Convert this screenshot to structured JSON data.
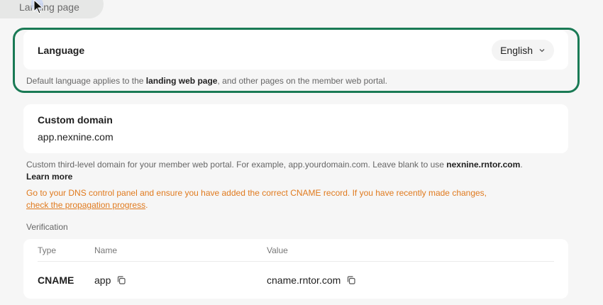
{
  "top_tab": {
    "label": "Landing page"
  },
  "language": {
    "title": "Language",
    "selected": "English",
    "help_prefix": "Default language applies to the ",
    "help_bold": "landing web page",
    "help_suffix": ", and other pages on the member web portal."
  },
  "custom_domain": {
    "title": "Custom domain",
    "value": "app.nexnine.com",
    "help_prefix": "Custom third-level domain for your member web portal. For example, app.yourdomain.com. Leave blank to use ",
    "help_bold": "nexnine.rntor.com",
    "help_suffix": ".",
    "learn_more": "Learn more",
    "warning_text": "Go to your DNS control panel and ensure you have added the correct CNAME record. If you have recently made changes,",
    "warning_link": "check the propagation progress",
    "warning_suffix": "."
  },
  "verification": {
    "label": "Verification",
    "columns": [
      "Type",
      "Name",
      "Value"
    ],
    "row": {
      "type": "CNAME",
      "name": "app",
      "value": "cname.rntor.com"
    }
  },
  "colors": {
    "highlight": "#1a7a55",
    "warning": "#e07a1e"
  }
}
